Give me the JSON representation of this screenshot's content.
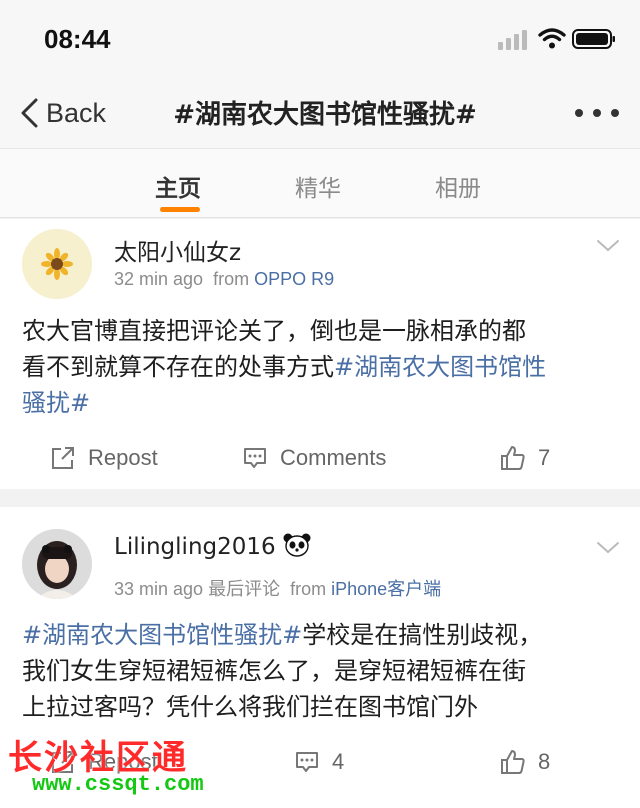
{
  "status_bar": {
    "time": "08:44"
  },
  "nav": {
    "back_label": "Back",
    "title": "#湖南农大图书馆性骚扰#"
  },
  "tabs": [
    {
      "label": "主页",
      "active": true
    },
    {
      "label": "精华",
      "active": false
    },
    {
      "label": "相册",
      "active": false
    }
  ],
  "posts": [
    {
      "username": "太阳小仙女z",
      "time_ago": "32 min ago",
      "from_label": "from",
      "source": "OPPO R9",
      "text_line1": "农大官博直接把评论关了，倒也是一脉相承的都",
      "text_line2_plain": "看不到就算不存在的处事方式",
      "text_line2_tag": "#湖南农大图书馆性",
      "text_line3_tag": "骚扰#",
      "repost_label": "Repost",
      "comments_label": "Comments",
      "likes": "7"
    },
    {
      "username": "Lilingling2016",
      "time_ago": "33 min ago",
      "extra": "最后评论",
      "from_label": "from",
      "source": "iPhone客户端",
      "text_line1_tag": "#湖南农大图书馆性骚扰#",
      "text_line1_plain": "学校是在搞性别歧视，",
      "text_line2": "我们女生穿短裙短裤怎么了，是穿短裙短裤在街",
      "text_line3": "上拉过客吗？凭什么将我们拦在图书馆门外",
      "repost_label": "Repost",
      "comments": "4",
      "likes": "8"
    }
  ],
  "watermark": {
    "name": "长沙社区通",
    "url": "www.cssqt.com"
  },
  "colors": {
    "accent": "#ff8200",
    "link": "#4a6fa5",
    "watermark_red": "#ff2a2a",
    "watermark_green": "#14c814"
  }
}
